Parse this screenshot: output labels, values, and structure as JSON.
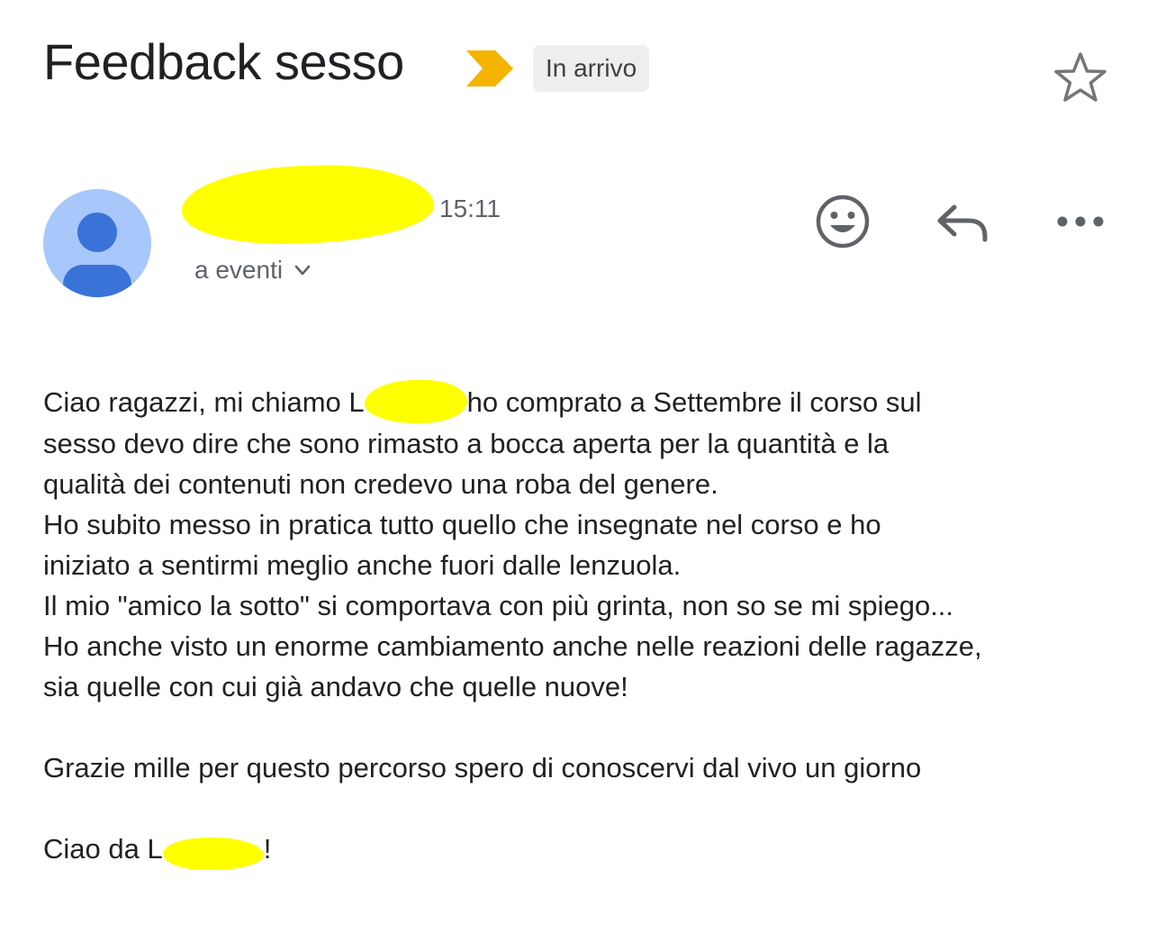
{
  "header": {
    "subject": "Feedback sesso",
    "label": "In arrivo"
  },
  "sender": {
    "time": "15:11",
    "recipient": "a eventi"
  },
  "colors": {
    "importance_marker": "#F4B400",
    "avatar_bg": "#A8C7FA",
    "avatar_fg": "#3A73D8",
    "redaction": "#FFFF00"
  },
  "icons": {
    "importance": "importance-marker-icon",
    "star": "star-icon",
    "emoji": "add-reaction-icon",
    "reply": "reply-icon",
    "more": "more-horizontal-icon",
    "chevron": "chevron-down-icon"
  },
  "body": {
    "l1_a": "Ciao ragazzi, mi chiamo L",
    "l1_b": "ho comprato a Settembre il corso sul",
    "l2": "sesso devo dire che sono rimasto a bocca aperta per la quantità e la",
    "l3": "qualità dei contenuti non credevo una roba del genere.",
    "l4": "Ho subito messo in pratica tutto quello che insegnate nel corso e ho",
    "l5": "iniziato a sentirmi meglio anche fuori dalle lenzuola.",
    "l6": "Il mio \"amico la sotto\" si comportava con più grinta, non so se mi spiego...",
    "l7": "Ho anche visto un enorme cambiamento anche nelle reazioni delle ragazze,",
    "l8": "sia quelle con cui già andavo che quelle nuove!",
    "l9": "Grazie mille per questo percorso spero di conoscervi dal vivo un giorno",
    "l10_a": "Ciao da L",
    "l10_b": "!"
  }
}
